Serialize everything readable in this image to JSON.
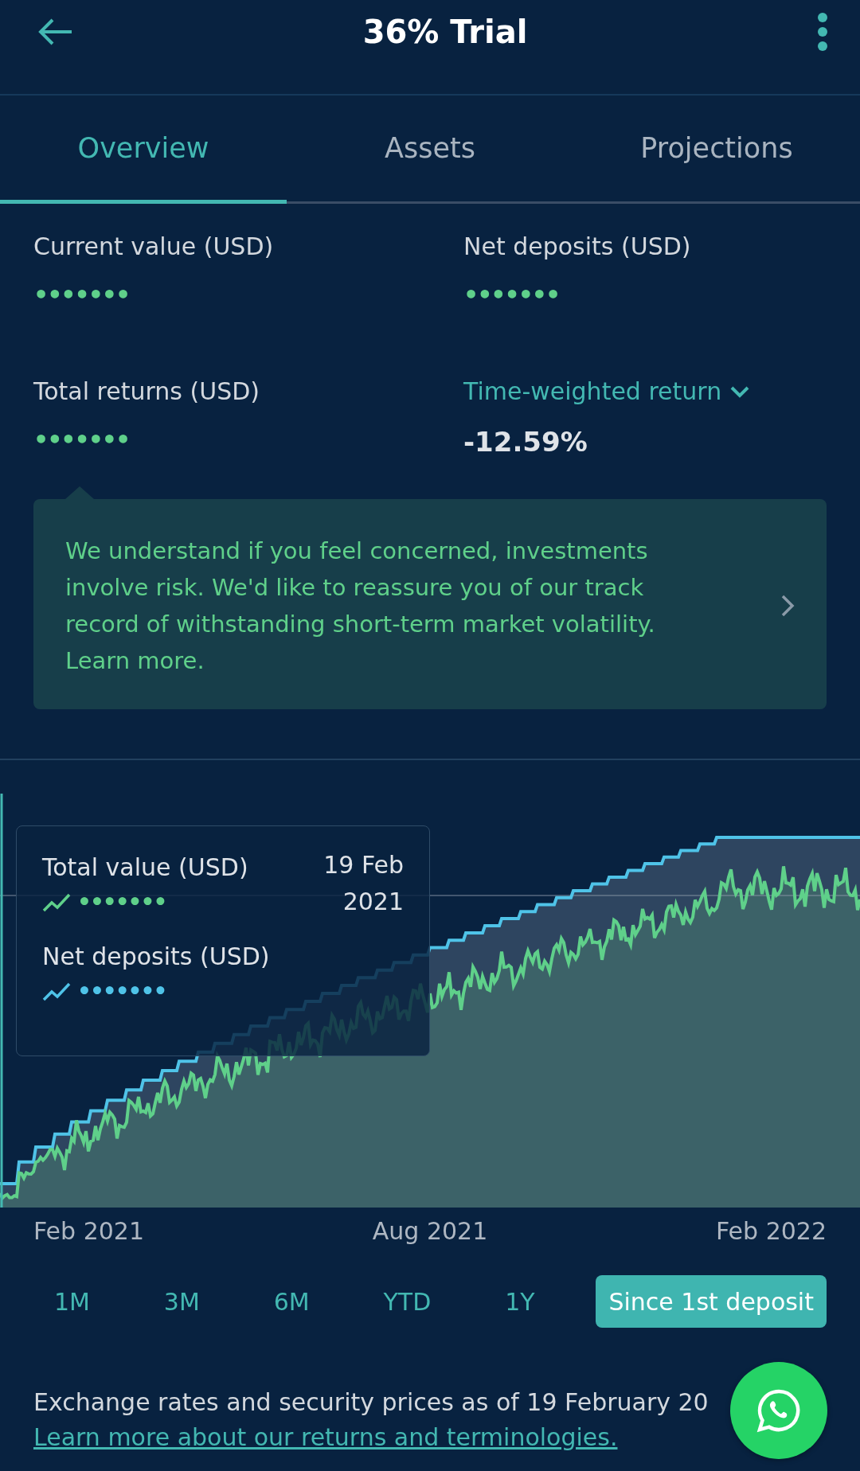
{
  "header": {
    "title": "36% Trial"
  },
  "tabs": [
    {
      "label": "Overview",
      "selected": true
    },
    {
      "label": "Assets",
      "selected": false
    },
    {
      "label": "Projections",
      "selected": false
    }
  ],
  "stats": [
    {
      "label": "Current value (USD)",
      "value": "•••••••",
      "kind": "masked"
    },
    {
      "label": "Net deposits (USD)",
      "value": "•••••••",
      "kind": "masked"
    },
    {
      "label": "Total returns (USD)",
      "value": "•••••••",
      "kind": "masked"
    },
    {
      "label": "Time-weighted return",
      "value": "-12.59%",
      "kind": "dropdown"
    }
  ],
  "notice": {
    "text": "We understand if you feel concerned, investments involve risk. We'd like to reassure you of our track record of withstanding short-term market volatility. Learn more."
  },
  "chart": {
    "x_labels": [
      "Feb 2021",
      "Aug 2021",
      "Feb 2022"
    ],
    "tooltip": {
      "date": "19 Feb 2021",
      "items": [
        {
          "label": "Total value (USD)",
          "value": "•••••••",
          "color": "#5fd08a"
        },
        {
          "label": "Net deposits (USD)",
          "value": "•••••••",
          "color": "#4fc3e8"
        }
      ]
    }
  },
  "periods": [
    {
      "label": "1M",
      "selected": false
    },
    {
      "label": "3M",
      "selected": false
    },
    {
      "label": "6M",
      "selected": false
    },
    {
      "label": "YTD",
      "selected": false
    },
    {
      "label": "1Y",
      "selected": false
    },
    {
      "label": "Since 1st deposit",
      "selected": true
    }
  ],
  "footer": {
    "note": "Exchange rates and security prices as of 19 February 20",
    "link": "Learn more about our returns and terminologies."
  }
}
